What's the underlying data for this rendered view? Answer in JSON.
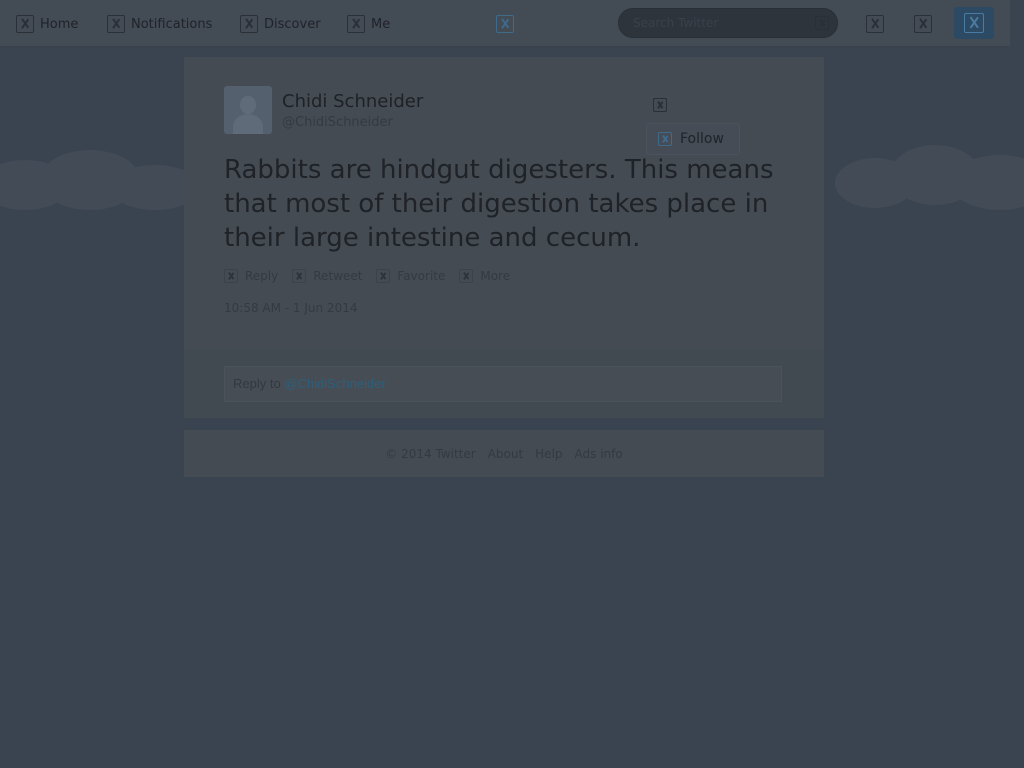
{
  "topbar": {
    "nav": [
      {
        "label": "Home",
        "icon": "home-icon"
      },
      {
        "label": "Notifications",
        "icon": "notifications-icon"
      },
      {
        "label": "Discover",
        "icon": "discover-icon"
      },
      {
        "label": "Me",
        "icon": "me-icon"
      }
    ],
    "search_placeholder": "Search Twitter",
    "icons": [
      "twitter-logo-icon",
      "search-icon",
      "direct-messages-icon",
      "settings-icon",
      "compose-tweet-icon"
    ]
  },
  "tweet": {
    "author_name": "Chidi Schneider",
    "author_handle": "@ChidiSchneider",
    "follow_label": "Follow",
    "text": "Rabbits are hindgut digesters. This means that most of their digestion takes place in their large intestine and cecum.",
    "actions": [
      {
        "label": "Reply",
        "icon": "reply-icon"
      },
      {
        "label": "Retweet",
        "icon": "retweet-icon"
      },
      {
        "label": "Favorite",
        "icon": "favorite-icon"
      },
      {
        "label": "More",
        "icon": "more-icon"
      }
    ],
    "timestamp": "10:58 AM - 1 Jun 2014"
  },
  "reply": {
    "prefix": "Reply to",
    "mention": "@ChidiSchneider"
  },
  "footer": {
    "copyright": "© 2014 Twitter",
    "links": [
      "About",
      "Help",
      "Ads info"
    ]
  },
  "colors": {
    "background": "#3a4350",
    "card": "#444b53",
    "accent": "#2e5f7a",
    "overlay": "dimmed"
  }
}
